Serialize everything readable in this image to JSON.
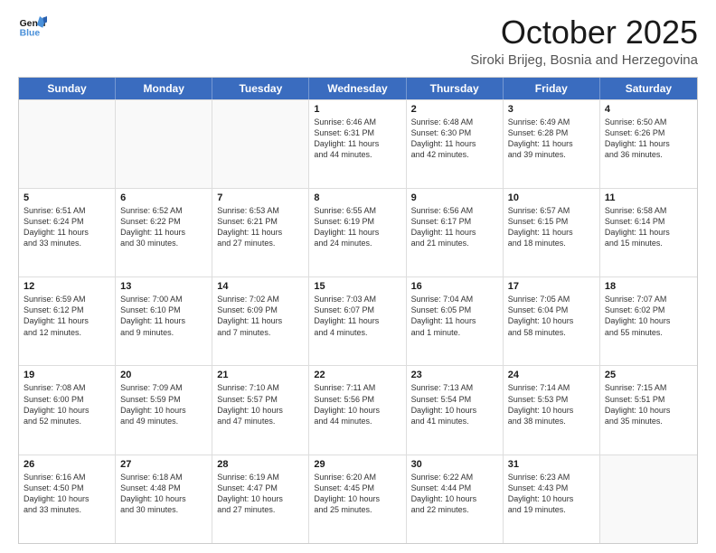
{
  "header": {
    "logo_general": "General",
    "logo_blue": "Blue",
    "month_title": "October 2025",
    "location": "Siroki Brijeg, Bosnia and Herzegovina"
  },
  "weekdays": [
    "Sunday",
    "Monday",
    "Tuesday",
    "Wednesday",
    "Thursday",
    "Friday",
    "Saturday"
  ],
  "rows": [
    [
      {
        "day": "",
        "text": ""
      },
      {
        "day": "",
        "text": ""
      },
      {
        "day": "",
        "text": ""
      },
      {
        "day": "1",
        "text": "Sunrise: 6:46 AM\nSunset: 6:31 PM\nDaylight: 11 hours\nand 44 minutes."
      },
      {
        "day": "2",
        "text": "Sunrise: 6:48 AM\nSunset: 6:30 PM\nDaylight: 11 hours\nand 42 minutes."
      },
      {
        "day": "3",
        "text": "Sunrise: 6:49 AM\nSunset: 6:28 PM\nDaylight: 11 hours\nand 39 minutes."
      },
      {
        "day": "4",
        "text": "Sunrise: 6:50 AM\nSunset: 6:26 PM\nDaylight: 11 hours\nand 36 minutes."
      }
    ],
    [
      {
        "day": "5",
        "text": "Sunrise: 6:51 AM\nSunset: 6:24 PM\nDaylight: 11 hours\nand 33 minutes."
      },
      {
        "day": "6",
        "text": "Sunrise: 6:52 AM\nSunset: 6:22 PM\nDaylight: 11 hours\nand 30 minutes."
      },
      {
        "day": "7",
        "text": "Sunrise: 6:53 AM\nSunset: 6:21 PM\nDaylight: 11 hours\nand 27 minutes."
      },
      {
        "day": "8",
        "text": "Sunrise: 6:55 AM\nSunset: 6:19 PM\nDaylight: 11 hours\nand 24 minutes."
      },
      {
        "day": "9",
        "text": "Sunrise: 6:56 AM\nSunset: 6:17 PM\nDaylight: 11 hours\nand 21 minutes."
      },
      {
        "day": "10",
        "text": "Sunrise: 6:57 AM\nSunset: 6:15 PM\nDaylight: 11 hours\nand 18 minutes."
      },
      {
        "day": "11",
        "text": "Sunrise: 6:58 AM\nSunset: 6:14 PM\nDaylight: 11 hours\nand 15 minutes."
      }
    ],
    [
      {
        "day": "12",
        "text": "Sunrise: 6:59 AM\nSunset: 6:12 PM\nDaylight: 11 hours\nand 12 minutes."
      },
      {
        "day": "13",
        "text": "Sunrise: 7:00 AM\nSunset: 6:10 PM\nDaylight: 11 hours\nand 9 minutes."
      },
      {
        "day": "14",
        "text": "Sunrise: 7:02 AM\nSunset: 6:09 PM\nDaylight: 11 hours\nand 7 minutes."
      },
      {
        "day": "15",
        "text": "Sunrise: 7:03 AM\nSunset: 6:07 PM\nDaylight: 11 hours\nand 4 minutes."
      },
      {
        "day": "16",
        "text": "Sunrise: 7:04 AM\nSunset: 6:05 PM\nDaylight: 11 hours\nand 1 minute."
      },
      {
        "day": "17",
        "text": "Sunrise: 7:05 AM\nSunset: 6:04 PM\nDaylight: 10 hours\nand 58 minutes."
      },
      {
        "day": "18",
        "text": "Sunrise: 7:07 AM\nSunset: 6:02 PM\nDaylight: 10 hours\nand 55 minutes."
      }
    ],
    [
      {
        "day": "19",
        "text": "Sunrise: 7:08 AM\nSunset: 6:00 PM\nDaylight: 10 hours\nand 52 minutes."
      },
      {
        "day": "20",
        "text": "Sunrise: 7:09 AM\nSunset: 5:59 PM\nDaylight: 10 hours\nand 49 minutes."
      },
      {
        "day": "21",
        "text": "Sunrise: 7:10 AM\nSunset: 5:57 PM\nDaylight: 10 hours\nand 47 minutes."
      },
      {
        "day": "22",
        "text": "Sunrise: 7:11 AM\nSunset: 5:56 PM\nDaylight: 10 hours\nand 44 minutes."
      },
      {
        "day": "23",
        "text": "Sunrise: 7:13 AM\nSunset: 5:54 PM\nDaylight: 10 hours\nand 41 minutes."
      },
      {
        "day": "24",
        "text": "Sunrise: 7:14 AM\nSunset: 5:53 PM\nDaylight: 10 hours\nand 38 minutes."
      },
      {
        "day": "25",
        "text": "Sunrise: 7:15 AM\nSunset: 5:51 PM\nDaylight: 10 hours\nand 35 minutes."
      }
    ],
    [
      {
        "day": "26",
        "text": "Sunrise: 6:16 AM\nSunset: 4:50 PM\nDaylight: 10 hours\nand 33 minutes."
      },
      {
        "day": "27",
        "text": "Sunrise: 6:18 AM\nSunset: 4:48 PM\nDaylight: 10 hours\nand 30 minutes."
      },
      {
        "day": "28",
        "text": "Sunrise: 6:19 AM\nSunset: 4:47 PM\nDaylight: 10 hours\nand 27 minutes."
      },
      {
        "day": "29",
        "text": "Sunrise: 6:20 AM\nSunset: 4:45 PM\nDaylight: 10 hours\nand 25 minutes."
      },
      {
        "day": "30",
        "text": "Sunrise: 6:22 AM\nSunset: 4:44 PM\nDaylight: 10 hours\nand 22 minutes."
      },
      {
        "day": "31",
        "text": "Sunrise: 6:23 AM\nSunset: 4:43 PM\nDaylight: 10 hours\nand 19 minutes."
      },
      {
        "day": "",
        "text": ""
      }
    ]
  ]
}
